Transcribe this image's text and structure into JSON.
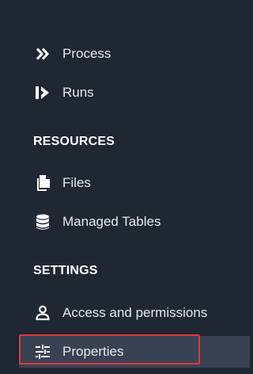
{
  "nav": {
    "process": {
      "label": "Process",
      "icon": "double-chevron-right-icon"
    },
    "runs": {
      "label": "Runs",
      "icon": "run-arrow-icon"
    }
  },
  "sections": {
    "resources": {
      "header": "RESOURCES",
      "items": [
        {
          "label": "Files",
          "icon": "file-icon"
        },
        {
          "label": "Managed Tables",
          "icon": "database-icon"
        }
      ]
    },
    "settings": {
      "header": "SETTINGS",
      "items": [
        {
          "label": "Access and permissions",
          "icon": "person-icon"
        },
        {
          "label": "Properties",
          "icon": "sliders-icon",
          "selected": true
        }
      ]
    }
  },
  "colors": {
    "background": "#1f2733",
    "text": "#e6e9ee",
    "selected_background": "#394252",
    "highlight_border": "#e0383e"
  }
}
